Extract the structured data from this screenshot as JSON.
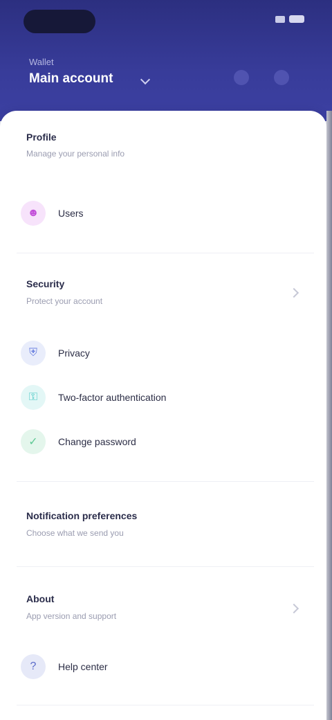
{
  "header": {
    "label": "Wallet",
    "title": "Main account",
    "icon_names": [
      "bell-icon",
      "settings-icon"
    ],
    "background_color": "#383c9a"
  },
  "sections": [
    {
      "title": "Profile",
      "subtitle": "Manage your personal info",
      "items": [
        {
          "label": "Users",
          "icon": "user-icon",
          "icon_glyph": "☻",
          "accent": "#c24fd9"
        }
      ]
    },
    {
      "title": "Security",
      "subtitle": "Protect your account",
      "items": [
        {
          "label": "Privacy",
          "icon": "shield-icon",
          "icon_glyph": "⛨",
          "accent": "#6d83e0"
        },
        {
          "label": "Two-factor authentication",
          "icon": "lock-icon",
          "icon_glyph": "⚿",
          "accent": "#46c7c4"
        },
        {
          "label": "Change password",
          "icon": "key-icon",
          "icon_glyph": "✓",
          "accent": "#5fc995"
        }
      ]
    },
    {
      "title": "Notification preferences",
      "subtitle": "Choose what we send you",
      "items": []
    },
    {
      "title": "About",
      "subtitle": "App version and support",
      "items": [
        {
          "label": "Help center",
          "icon": "help-icon",
          "icon_glyph": "?",
          "accent": "#5a6bc9"
        }
      ]
    }
  ]
}
